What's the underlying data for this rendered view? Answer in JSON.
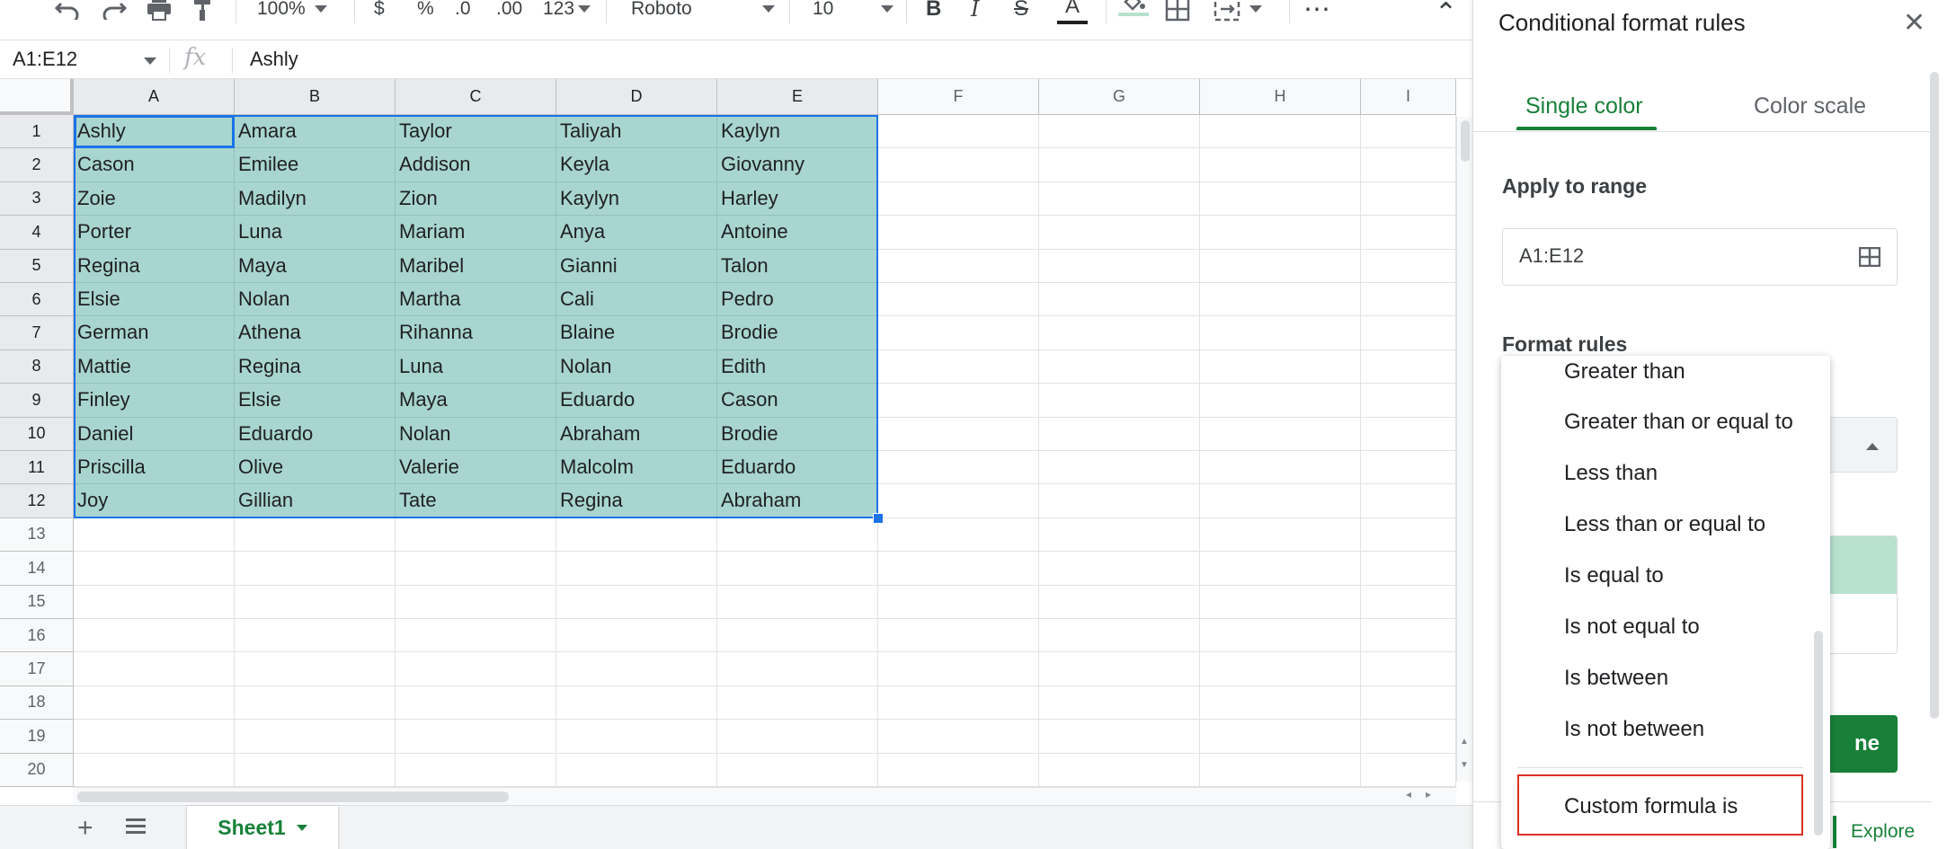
{
  "toolbar": {
    "zoom": "100%",
    "currency": "$",
    "percent": "%",
    "decrease_decimals": ".0",
    "increase_decimals": ".00",
    "number_format": "123",
    "font": "Roboto",
    "font_size": "10",
    "bold": "B",
    "italic": "I",
    "strikethrough": "S",
    "text_color": "A",
    "more": "⋯",
    "collapse": "⌃"
  },
  "formula_bar": {
    "name_box": "A1:E12",
    "fx": "fx",
    "value": "Ashly"
  },
  "columns": [
    "A",
    "B",
    "C",
    "D",
    "E",
    "F",
    "G",
    "H",
    "I"
  ],
  "rows": [
    "1",
    "2",
    "3",
    "4",
    "5",
    "6",
    "7",
    "8",
    "9",
    "10",
    "11",
    "12",
    "13",
    "14",
    "15",
    "16",
    "17",
    "18",
    "19",
    "20"
  ],
  "cells": [
    [
      "Ashly",
      "Amara",
      "Taylor",
      "Taliyah",
      "Kaylyn"
    ],
    [
      "Cason",
      "Emilee",
      "Addison",
      "Keyla",
      "Giovanny"
    ],
    [
      "Zoie",
      "Madilyn",
      "Zion",
      "Kaylyn",
      "Harley"
    ],
    [
      "Porter",
      "Luna",
      "Mariam",
      "Anya",
      "Antoine"
    ],
    [
      "Regina",
      "Maya",
      "Maribel",
      "Gianni",
      "Talon"
    ],
    [
      "Elsie",
      "Nolan",
      "Martha",
      "Cali",
      "Pedro"
    ],
    [
      "German",
      "Athena",
      "Rihanna",
      "Blaine",
      "Brodie"
    ],
    [
      "Mattie",
      "Regina",
      "Luna",
      "Nolan",
      "Edith"
    ],
    [
      "Finley",
      "Elsie",
      "Maya",
      "Eduardo",
      "Cason"
    ],
    [
      "Daniel",
      "Eduardo",
      "Nolan",
      "Abraham",
      "Brodie"
    ],
    [
      "Priscilla",
      "Olive",
      "Valerie",
      "Malcolm",
      "Eduardo"
    ],
    [
      "Joy",
      "Gillian",
      "Tate",
      "Regina",
      "Abraham"
    ]
  ],
  "colors": {
    "highlight": "#a8d5cf",
    "selection": "#1a73e8",
    "accent_green": "#188038",
    "menu_highlight": "#d93025"
  },
  "sheet_tabs": {
    "add": "+",
    "active": "Sheet1"
  },
  "panel": {
    "title": "Conditional format rules",
    "close": "✕",
    "tabs": [
      "Single color",
      "Color scale"
    ],
    "apply_label": "Apply to range",
    "range_value": "A1:E12",
    "format_rules_label": "Format rules",
    "done_partial": "ne",
    "explore": "Explore"
  },
  "menu": {
    "items": [
      "Greater than",
      "Greater than or equal to",
      "Less than",
      "Less than or equal to",
      "Is equal to",
      "Is not equal to",
      "Is between",
      "Is not between"
    ],
    "custom": "Custom formula is"
  }
}
